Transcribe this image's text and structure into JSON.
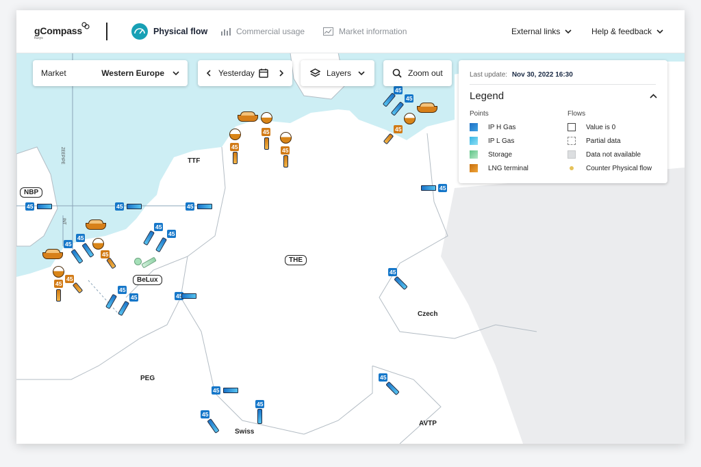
{
  "app": {
    "logo": "gCompass",
    "logo_sub": "fluxys"
  },
  "nav": {
    "physical_flow": "Physical flow",
    "commercial_usage": "Commercial usage",
    "market_information": "Market information",
    "external_links": "External links",
    "help_feedback": "Help & feedback"
  },
  "controls": {
    "market_label": "Market",
    "market_value": "Western Europe",
    "date_value": "Yesterday",
    "layers_label": "Layers",
    "zoom_out_label": "Zoom out"
  },
  "legend": {
    "last_update_label": "Last update:",
    "last_update_value": "Nov 30, 2022 16:30",
    "title": "Legend",
    "points_header": "Points",
    "flows_header": "Flows",
    "points": [
      "IP H Gas",
      "IP L Gas",
      "Storage",
      "LNG terminal"
    ],
    "flows": [
      "Value is 0",
      "Partial data",
      "Data not available",
      "Counter Physical flow"
    ],
    "colors": {
      "ip_h_gas": "#1677c9",
      "ip_l_gas": "#4fc3ec",
      "storage": "#7fd19a",
      "lng": "#d17a16"
    }
  },
  "map": {
    "regions": {
      "ttf": "TTF",
      "nbp": "NBP",
      "the": "THE",
      "belux": "BeLux",
      "czech": "Czech",
      "peg": "PEG",
      "avtp": "AVTP",
      "swiss": "Swiss",
      "zeepipe": "ZEEPIPE",
      "int": "INT"
    },
    "value": "45"
  },
  "colors": {
    "accent": "#17a0b5",
    "water": "#cdeef4",
    "land": "#ffffff",
    "border": "#b3bcc4"
  }
}
